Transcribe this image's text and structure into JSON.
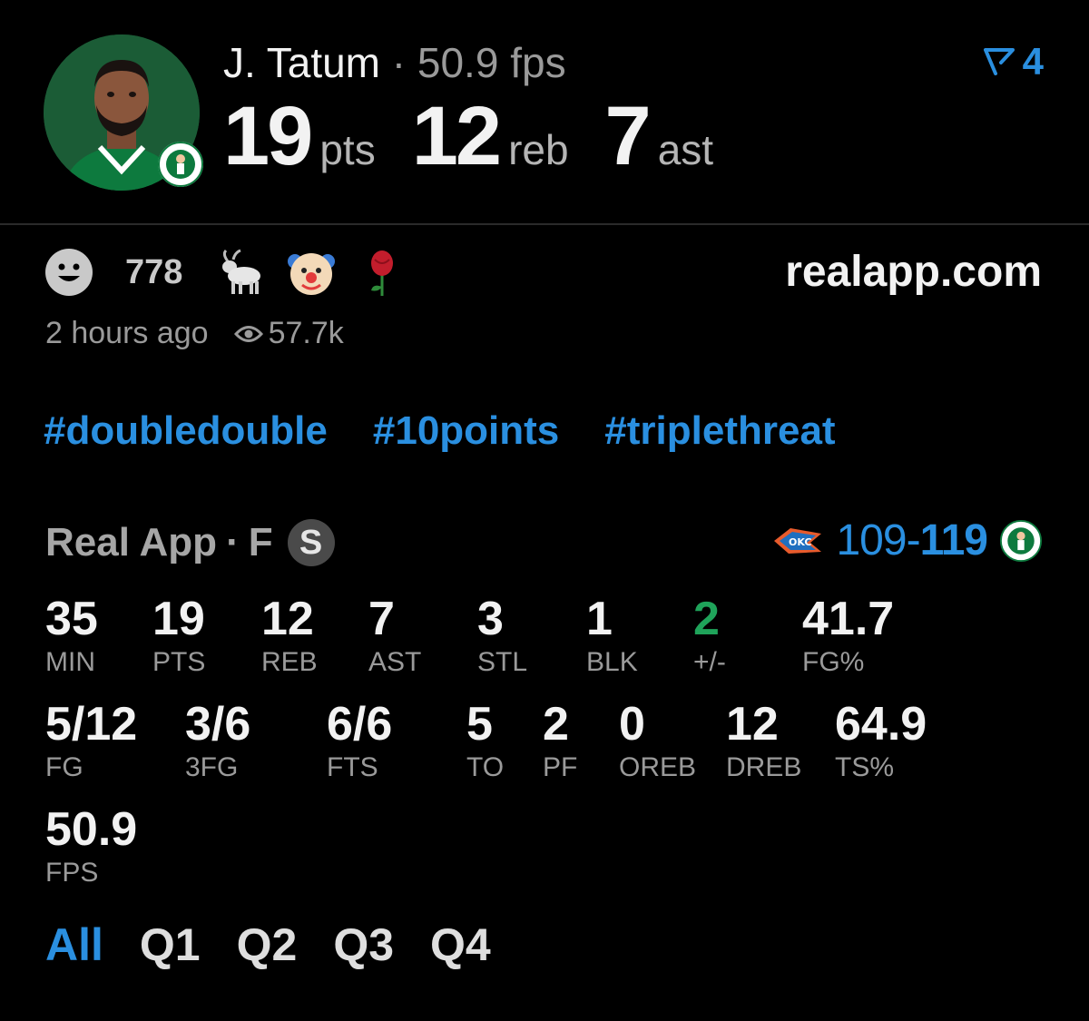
{
  "player": {
    "name": "J. Tatum",
    "separator": "·",
    "fps_label": "50.9 fps",
    "pts_value": "19",
    "pts_unit": "pts",
    "reb_value": "12",
    "reb_unit": "reb",
    "ast_value": "7",
    "ast_unit": "ast"
  },
  "share": {
    "icon": "share-arrow-icon",
    "count": "4"
  },
  "reactions": {
    "smiley_count": "778",
    "icons": [
      "smiley-icon",
      "goat-icon",
      "clown-icon",
      "rose-icon"
    ]
  },
  "site": "realapp.com",
  "meta": {
    "time_ago": "2 hours ago",
    "views": "57.7k"
  },
  "hashtags": [
    "#doubledouble",
    "#10points",
    "#triplethreat"
  ],
  "game": {
    "source": "Real App",
    "separator": "·",
    "status": "F",
    "badge": "S",
    "away_score": "109",
    "dash": "-",
    "home_score": "119"
  },
  "stats": {
    "min": {
      "value": "35",
      "label": "MIN"
    },
    "pts": {
      "value": "19",
      "label": "PTS"
    },
    "reb": {
      "value": "12",
      "label": "REB"
    },
    "ast": {
      "value": "7",
      "label": "AST"
    },
    "stl": {
      "value": "3",
      "label": "STL"
    },
    "blk": {
      "value": "1",
      "label": "BLK"
    },
    "pm": {
      "value": "2",
      "label": "+/-"
    },
    "fgp": {
      "value": "41.7",
      "label": "FG%"
    },
    "fg": {
      "value": "5/12",
      "label": "FG"
    },
    "tfg": {
      "value": "3/6",
      "label": "3FG"
    },
    "fts": {
      "value": "6/6",
      "label": "FTS"
    },
    "to": {
      "value": "5",
      "label": "TO"
    },
    "pf": {
      "value": "2",
      "label": "PF"
    },
    "oreb": {
      "value": "0",
      "label": "OREB"
    },
    "dreb": {
      "value": "12",
      "label": "DREB"
    },
    "tsp": {
      "value": "64.9",
      "label": "TS%"
    },
    "fps": {
      "value": "50.9",
      "label": "FPS"
    }
  },
  "tabs": [
    {
      "label": "All",
      "active": true
    },
    {
      "label": "Q1",
      "active": false
    },
    {
      "label": "Q2",
      "active": false
    },
    {
      "label": "Q3",
      "active": false
    },
    {
      "label": "Q4",
      "active": false
    }
  ],
  "colors": {
    "accent": "#2a8fe0",
    "positive": "#1fa35a",
    "background": "#000000"
  }
}
